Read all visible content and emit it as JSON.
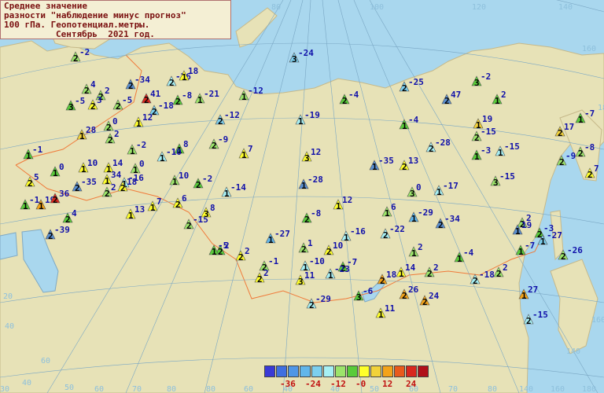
{
  "title": {
    "line1": "Среднее значение",
    "line2": "разности \"наблюдение минус прогноз\"",
    "line3": "100 гПа. Геопотенциал.метры.",
    "line4": "Сентябрь  2021 год."
  },
  "legend": {
    "colors": [
      "#3a3ad6",
      "#3f6fe0",
      "#4f96e6",
      "#62b6ea",
      "#7ccfee",
      "#a7f0f4",
      "#9ce46a",
      "#5acb3a",
      "#ffff2a",
      "#f2d23a",
      "#f3a31a",
      "#e85a1c",
      "#d8281e",
      "#b0101a"
    ],
    "labels": [
      "-36",
      "-24",
      "-12",
      "-0",
      "12",
      "24"
    ]
  },
  "graticule_labels": [
    "80",
    "100",
    "120",
    "140",
    "160",
    "180",
    "160",
    "140",
    "60",
    "40",
    "20",
    "30",
    "40",
    "50",
    "60",
    "70",
    "80",
    "80",
    "60",
    "40",
    "40",
    "50",
    "60",
    "70",
    "80",
    "140",
    "160",
    "180"
  ],
  "stations": [
    {
      "v": "-2",
      "n": "2",
      "c": "#9ce46a"
    },
    {
      "v": "4",
      "n": "2",
      "c": "#9ce46a"
    },
    {
      "v": "2",
      "n": "2",
      "c": "#9ce46a"
    },
    {
      "v": "-5",
      "n": "3",
      "c": "#5acb3a"
    },
    {
      "v": "3",
      "n": "2",
      "c": "#ffff2a"
    },
    {
      "v": "-5",
      "n": "2",
      "c": "#9ce46a"
    },
    {
      "v": "-34",
      "n": "2",
      "c": "#5a8fd0"
    },
    {
      "v": "41",
      "n": "2",
      "c": "#d8281e"
    },
    {
      "v": "-18",
      "n": "2",
      "c": "#7ccfee"
    },
    {
      "v": "-26",
      "n": "2",
      "c": "#a7f0f4"
    },
    {
      "v": "-8",
      "n": "2",
      "c": "#5acb3a"
    },
    {
      "v": "18",
      "n": "1",
      "c": "#ffff2a"
    },
    {
      "v": "-21",
      "n": "1",
      "c": "#9ce46a"
    },
    {
      "v": "-24",
      "n": "3",
      "c": "#7ccfee"
    },
    {
      "v": "-12",
      "n": "1",
      "c": "#9ce46a"
    },
    {
      "v": "-4",
      "n": "2",
      "c": "#5acb3a"
    },
    {
      "v": "-25",
      "n": "2",
      "c": "#7ccfee"
    },
    {
      "v": "-2",
      "n": "3",
      "c": "#5acb3a"
    },
    {
      "v": "47",
      "n": "2",
      "c": "#5a8fd0"
    },
    {
      "v": "2",
      "n": "1",
      "c": "#5acb3a"
    },
    {
      "v": "-7",
      "n": "1",
      "c": "#5acb3a"
    },
    {
      "v": "0",
      "n": "2",
      "c": "#9ce46a"
    },
    {
      "v": "12",
      "n": "1",
      "c": "#ffff2a"
    },
    {
      "v": "-12",
      "n": "2",
      "c": "#7ccfee"
    },
    {
      "v": "-19",
      "n": "1",
      "c": "#a7f0f4"
    },
    {
      "v": "-4",
      "n": "1",
      "c": "#5acb3a"
    },
    {
      "v": "19",
      "n": "1",
      "c": "#f2d23a"
    },
    {
      "v": "-15",
      "n": "2",
      "c": "#9ce46a"
    },
    {
      "v": "17",
      "n": "2",
      "c": "#f2d23a"
    },
    {
      "v": "-8",
      "n": "2",
      "c": "#9ce46a"
    },
    {
      "v": "28",
      "n": "1",
      "c": "#f2d23a"
    },
    {
      "v": "2",
      "n": "2",
      "c": "#9ce46a"
    },
    {
      "v": "-2",
      "n": "1",
      "c": "#9ce46a"
    },
    {
      "v": "8",
      "n": "1",
      "c": "#5acb3a"
    },
    {
      "v": "-9",
      "n": "2",
      "c": "#9ce46a"
    },
    {
      "v": "7",
      "n": "1",
      "c": "#ffff2a"
    },
    {
      "v": "12",
      "n": "3",
      "c": "#ffff2a"
    },
    {
      "v": "-28",
      "n": "2",
      "c": "#a7f0f4"
    },
    {
      "v": "-3",
      "n": "1",
      "c": "#5acb3a"
    },
    {
      "v": "-15",
      "n": "1",
      "c": "#a7f0f4"
    },
    {
      "v": "-9",
      "n": "2",
      "c": "#9ce46a"
    },
    {
      "v": "7",
      "n": "2",
      "c": "#ffff2a"
    },
    {
      "v": "-1",
      "n": "1",
      "c": "#5acb3a"
    },
    {
      "v": "0",
      "n": "1",
      "c": "#5acb3a"
    },
    {
      "v": "10",
      "n": "1",
      "c": "#ffff2a"
    },
    {
      "v": "14",
      "n": "1",
      "c": "#ffff2a"
    },
    {
      "v": "0",
      "n": "1",
      "c": "#9ce46a"
    },
    {
      "v": "-10",
      "n": "1",
      "c": "#a7f0f4"
    },
    {
      "v": "-35",
      "n": "1",
      "c": "#5a8fd0"
    },
    {
      "v": "13",
      "n": "2",
      "c": "#ffff2a"
    },
    {
      "v": "-15",
      "n": "3",
      "c": "#9ce46a"
    },
    {
      "v": "5",
      "n": "2",
      "c": "#ffff2a"
    },
    {
      "v": "-35",
      "n": "2",
      "c": "#5a8fd0"
    },
    {
      "v": "34",
      "n": "1",
      "c": "#ffff2a"
    },
    {
      "v": "-16",
      "n": "1",
      "c": "#a7f0f4"
    },
    {
      "v": "10",
      "n": "1",
      "c": "#9ce46a"
    },
    {
      "v": "-2",
      "n": "2",
      "c": "#5acb3a"
    },
    {
      "v": "-14",
      "n": "1",
      "c": "#a7f0f4"
    },
    {
      "v": "-28",
      "n": "1",
      "c": "#5a8fd0"
    },
    {
      "v": "0",
      "n": "3",
      "c": "#9ce46a"
    },
    {
      "v": "-17",
      "n": "1",
      "c": "#a7f0f4"
    },
    {
      "v": "19",
      "n": "1",
      "c": "#f3a31a"
    },
    {
      "v": "36",
      "n": "2",
      "c": "#d8281e"
    },
    {
      "v": "7",
      "n": "1",
      "c": "#ffff2a"
    },
    {
      "v": "6",
      "n": "1",
      "c": "#9ce46a"
    },
    {
      "v": "12",
      "n": "1",
      "c": "#ffff2a"
    },
    {
      "v": "-29",
      "n": "1",
      "c": "#62b6ea"
    },
    {
      "v": "-34",
      "n": "2",
      "c": "#5a8fd0"
    },
    {
      "v": "4",
      "n": "2",
      "c": "#5acb3a"
    },
    {
      "v": "13",
      "n": "1",
      "c": "#ffff2a"
    },
    {
      "v": "6",
      "n": "2",
      "c": "#ffff2a"
    },
    {
      "v": "-15",
      "n": "2",
      "c": "#9ce46a"
    },
    {
      "v": "8",
      "n": "3",
      "c": "#ffff2a"
    },
    {
      "v": "-8",
      "n": "2",
      "c": "#5acb3a"
    },
    {
      "v": "2",
      "n": "2",
      "c": "#9ce46a"
    },
    {
      "v": "-3",
      "n": "2",
      "c": "#5acb3a"
    },
    {
      "v": "-27",
      "n": "1",
      "c": "#7ccfee"
    },
    {
      "v": "19",
      "n": "1",
      "c": "#5a8fd0"
    },
    {
      "v": "2",
      "n": "2",
      "c": "#5acb3a"
    },
    {
      "v": "-27",
      "n": "1",
      "c": "#62b6ea"
    },
    {
      "v": "-16",
      "n": "1",
      "c": "#a7f0f4"
    },
    {
      "v": "-22",
      "n": "2",
      "c": "#a7f0f4"
    },
    {
      "v": "2",
      "n": "1",
      "c": "#9ce46a"
    },
    {
      "v": "-7",
      "n": "1",
      "c": "#5acb3a"
    },
    {
      "v": "-26",
      "n": "2",
      "c": "#9ce46a"
    },
    {
      "v": "-39",
      "n": "2",
      "c": "#5a8fd0"
    },
    {
      "v": "2",
      "n": "2",
      "c": "#ffff2a"
    },
    {
      "v": "1",
      "n": "2",
      "c": "#9ce46a"
    },
    {
      "v": "10",
      "n": "2",
      "c": "#ffff2a"
    },
    {
      "v": "-4",
      "n": "1",
      "c": "#5acb3a"
    },
    {
      "v": "-1",
      "n": "2",
      "c": "#9ce46a"
    },
    {
      "v": "-10",
      "n": "1",
      "c": "#a7f0f4"
    },
    {
      "v": "-7",
      "n": "2",
      "c": "#5acb3a"
    },
    {
      "v": "14",
      "n": "1",
      "c": "#ffff2a"
    },
    {
      "v": "2",
      "n": "2",
      "c": "#9ce46a"
    },
    {
      "v": "2",
      "n": "2",
      "c": "#9ce46a"
    },
    {
      "v": "2",
      "n": "2",
      "c": "#ffff2a"
    },
    {
      "v": "11",
      "n": "3",
      "c": "#ffff2a"
    },
    {
      "v": "-23",
      "n": "1",
      "c": "#a7f0f4"
    },
    {
      "v": "18",
      "n": "2",
      "c": "#f3a31a"
    },
    {
      "v": "-18",
      "n": "2",
      "c": "#a7f0f4"
    },
    {
      "v": "27",
      "n": "1",
      "c": "#f3a31a"
    },
    {
      "v": "-29",
      "n": "2",
      "c": "#a7f0f4"
    },
    {
      "v": "-6",
      "n": "3",
      "c": "#5acb3a"
    },
    {
      "v": "26",
      "n": "2",
      "c": "#f3a31a"
    },
    {
      "v": "24",
      "n": "2",
      "c": "#f3a31a"
    },
    {
      "v": "11",
      "n": "1",
      "c": "#ffff2a"
    },
    {
      "v": "-15",
      "n": "2",
      "c": "#a7f0f4"
    },
    {
      "v": "18",
      "n": "2",
      "c": "#ffff2a"
    },
    {
      "v": "-1",
      "n": "1",
      "c": "#5acb3a"
    },
    {
      "v": "2",
      "n": "2",
      "c": "#9ce46a"
    },
    {
      "v": "-5",
      "n": "1",
      "c": "#5acb3a"
    },
    {
      "v": "-2",
      "n": "1",
      "c": "#5acb3a"
    }
  ]
}
